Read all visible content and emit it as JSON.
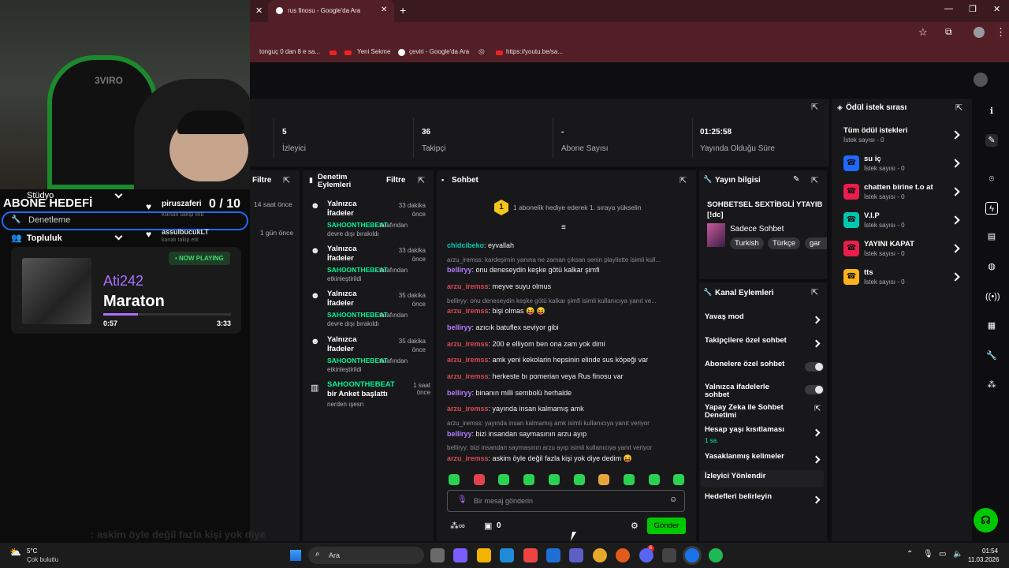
{
  "browser": {
    "tab_title": "rus finosu - Google'da Ara",
    "bookmarks": [
      "tonguç 0 dan 8 e sa...",
      "Yeni Sekme",
      "çeviri - Google'da Ara",
      "https://youtu.be/sa..."
    ]
  },
  "stream_overlay": {
    "goal_title": "ABONE HEDEFİ",
    "nav_items": [
      "Stüdyo",
      "Denetleme",
      "Topluluk"
    ],
    "followers": [
      {
        "name": "piruszaferi",
        "sub": "kanalı takip etti",
        "time": "14 saat önce"
      },
      {
        "name": "assulbucukLT",
        "sub": "kanalı takip etti",
        "time": "1 gün önce"
      }
    ],
    "goal_progress": "0 / 10",
    "now_playing_label": "• NOW PLAYING",
    "artist": "Ati242",
    "song": "Maraton",
    "time_elapsed": "0:57",
    "time_total": "3:33",
    "progress_fraction": 0.27
  },
  "stats": [
    {
      "value": "5",
      "label": "İzleyici"
    },
    {
      "value": "36",
      "label": "Takipçi"
    },
    {
      "value": "-",
      "label": "Abone Sayısı"
    },
    {
      "value": "01:25:58",
      "label": "Yayında Olduğu Süre"
    }
  ],
  "filter_panel": {
    "filter_label": "Filtre"
  },
  "mod_actions": {
    "title": "Denetim Eylemleri",
    "filter": "Filtre",
    "items": [
      {
        "title": "Yalnızca İfadeler",
        "time": "33 dakika önce",
        "actor": "SAHOONTHEBEAT",
        "desc": "tarafından devre dışı bırakıldı"
      },
      {
        "title": "Yalnızca İfadeler",
        "time": "33 dakika önce",
        "actor": "SAHOONTHEBEAT",
        "desc": "tarafından etkinleştirildi"
      },
      {
        "title": "Yalnızca İfadeler",
        "time": "35 dakika önce",
        "actor": "SAHOONTHEBEAT",
        "desc": "tarafından devre dışı bırakıldı"
      },
      {
        "title": "Yalnızca İfadeler",
        "time": "35 dakika önce",
        "actor": "SAHOONTHEBEAT",
        "desc": "tarafından etkinleştirildi"
      }
    ],
    "poll": {
      "actor": "SAHOONTHEBEAT",
      "text": "bir Anket başlattı",
      "time": "1 saat önce",
      "sub": "nerden ışesn"
    }
  },
  "chat": {
    "title": "Sohbet",
    "gift_rank": "1",
    "gift_banner": "1 abonelik hediye ederek 1. sıraya yükselin",
    "messages": [
      {
        "kind": "msg",
        "user": "chidcibeko",
        "color": "g",
        "text": ": eyvallah"
      },
      {
        "kind": "reply",
        "text": "arzu_iremss: kardeşimin yanına ne zaman çıksan senin playlistte isimli kull..."
      },
      {
        "kind": "msg",
        "user": "belliryy",
        "color": "p",
        "text": ": onu deneseydin keşke götü kalkar şimfi"
      },
      {
        "kind": "msg",
        "user": "arzu_iremss",
        "color": "r",
        "text": ": meyve suyu olmus"
      },
      {
        "kind": "reply",
        "text": "belliryy: onu deneseydin keşke götü kalkar şimfi isimli kullanıcıya yanıt ve..."
      },
      {
        "kind": "msg",
        "user": "arzu_iremss",
        "color": "r",
        "text": ": bişi olmas 😝 😝"
      },
      {
        "kind": "msg",
        "user": "belliryy",
        "color": "p",
        "text": ": azıcık batuflex seviyor gibi"
      },
      {
        "kind": "msg",
        "user": "arzu_iremss",
        "color": "r",
        "text": ": 200 e elliyom ben ona zam yok dimi"
      },
      {
        "kind": "msg",
        "user": "arzu_iremss",
        "color": "r",
        "text": ": amk yeni kekolarin hepsinin elinde sus köpeği var"
      },
      {
        "kind": "msg",
        "user": "arzu_iremss",
        "color": "r",
        "text": ": herkeste bı pomerian veya Rus finosu var"
      },
      {
        "kind": "msg",
        "user": "belliryy",
        "color": "p",
        "text": ": binanın milli sembolü herhalde"
      },
      {
        "kind": "msg",
        "user": "arzu_iremss",
        "color": "r",
        "text": ": yayında insan kalmamış amk"
      },
      {
        "kind": "reply",
        "text": "arzu_iremss: yayında insan kalmamış amk isimli kullanıcıya yanıt veriyor"
      },
      {
        "kind": "msg",
        "user": "belliryy",
        "color": "p",
        "text": ": bizi insandan saymasının arzu ayıp"
      },
      {
        "kind": "reply",
        "text": "belliryy: bizi insandan saymasının arzu ayıp isimli kullanıcıya yanıt veriyor"
      },
      {
        "kind": "msg",
        "user": "arzu_iremss",
        "color": "r",
        "text": ": askim öyle değil fazla kişi yok diye dedim 😝"
      }
    ],
    "input_placeholder": "Bir mesaj gönderin",
    "points": "0",
    "send_label": "Gönder",
    "overlay_ghost": ": askim öyle değil fazla kişi yok diye"
  },
  "stream_info": {
    "title": "Yayın bilgisi",
    "stream_title": "SOHBETSEL SEXTİBGLİ YTAYIB [!dc]",
    "category": "Sadece Sohbet",
    "tags": [
      "Turkish",
      "Türkçe",
      "gar"
    ]
  },
  "channel_actions": {
    "title": "Kanal Eylemleri",
    "items": [
      {
        "label": "Yavaş mod",
        "type": "chevron"
      },
      {
        "label": "Takipçilere özel sohbet",
        "type": "chevron"
      },
      {
        "label": "Abonelere özel sohbet",
        "type": "toggle"
      },
      {
        "label": "Yalnızca ifadelerle sohbet",
        "type": "toggle"
      },
      {
        "label": "Yapay Zeka ile Sohbet Denetimi",
        "type": "external"
      },
      {
        "label": "Hesap yaşı kısıtlaması",
        "type": "chevron",
        "sub": "1 sa."
      },
      {
        "label": "Yasaklanmış kelimeler",
        "type": "chevron"
      },
      {
        "label": "İzleyici Yönlendir",
        "type": "none"
      },
      {
        "label": "Hedefleri belirleyin",
        "type": "chevron"
      }
    ]
  },
  "rewards": {
    "title": "Ödül istek sırası",
    "all_label": "Tüm ödül istekleri",
    "all_sub": "İstek sayısı - 0",
    "items": [
      {
        "name": "su iç",
        "sub": "İstek sayısı - 0",
        "color": "#1f69ff"
      },
      {
        "name": "chatten birine t.o at",
        "sub": "İstek sayısı - 0",
        "color": "#e91e4c"
      },
      {
        "name": "V.I.P",
        "sub": "İstek sayısı - 0",
        "color": "#00c8af"
      },
      {
        "name": "YAYINI KAPAT",
        "sub": "İstek sayısı - 0",
        "color": "#e91e4c"
      },
      {
        "name": "tts",
        "sub": "İstek sayısı - 0",
        "color": "#ffb31a"
      }
    ]
  },
  "taskbar": {
    "temp": "5°C",
    "weather": "Çok bulutlu",
    "search": "Ara",
    "time": "01:54",
    "date": "11.03.2026",
    "badge": "6"
  }
}
